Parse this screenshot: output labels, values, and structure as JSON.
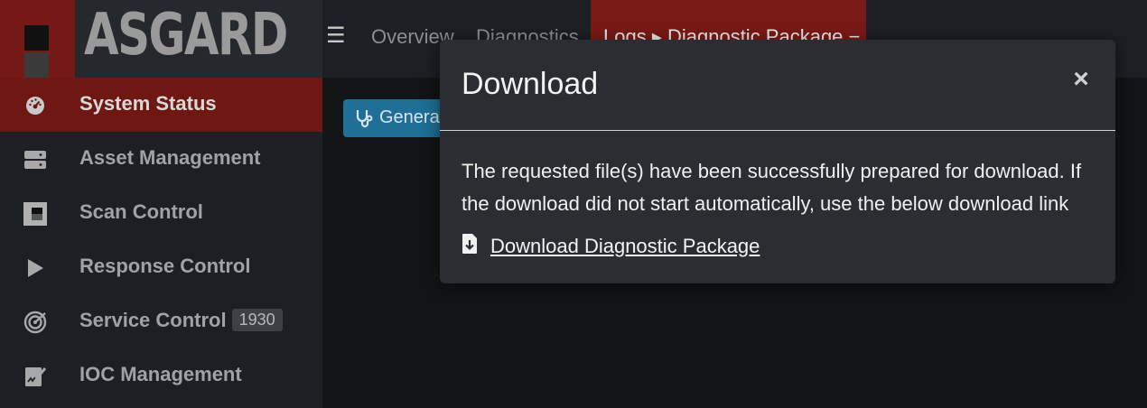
{
  "app": {
    "brand": "ASGARD"
  },
  "topnav": {
    "links": [
      "Overview",
      "Diagnostics"
    ],
    "active": "Logs ▸ Diagnostic Package −"
  },
  "sidebar": {
    "items": [
      {
        "label": "System Status",
        "icon": "dashboard-icon",
        "active": true
      },
      {
        "label": "Asset Management",
        "icon": "server-icon"
      },
      {
        "label": "Scan Control",
        "icon": "scan-icon"
      },
      {
        "label": "Response Control",
        "icon": "play-icon"
      },
      {
        "label": "Service Control",
        "icon": "radar-icon",
        "badge": "1930"
      },
      {
        "label": "IOC Management",
        "icon": "signature-icon"
      }
    ]
  },
  "content": {
    "generate_button": "Generate"
  },
  "modal": {
    "title": "Download",
    "close": "×",
    "body": "The requested file(s) have been successfully prepared for download. If the download did not start automatically, use the below download link",
    "link": "Download Diagnostic Package"
  },
  "colors": {
    "accent_red": "#741915",
    "button_blue": "#1f6f96",
    "modal_bg": "#2a2d31"
  }
}
